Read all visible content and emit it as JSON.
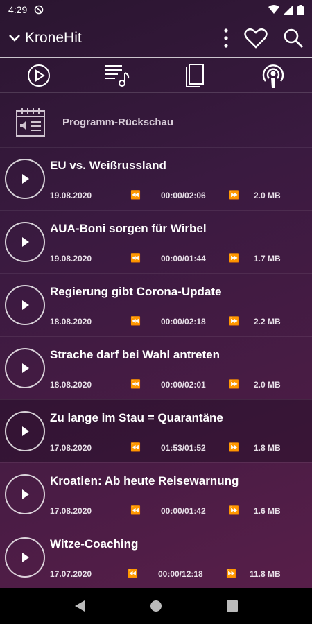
{
  "status": {
    "time": "4:29"
  },
  "appbar": {
    "title": "KroneHit"
  },
  "section": {
    "label": "Programm-Rückschau"
  },
  "episodes": [
    {
      "title": "EU vs. Weißrussland",
      "date": "19.08.2020",
      "position": "00:00/02:06",
      "size": "2.0 MB"
    },
    {
      "title": "AUA-Boni sorgen für Wirbel",
      "date": "19.08.2020",
      "position": "00:00/01:44",
      "size": "1.7 MB"
    },
    {
      "title": "Regierung gibt Corona-Update",
      "date": "18.08.2020",
      "position": "00:00/02:18",
      "size": "2.2 MB"
    },
    {
      "title": "Strache darf bei Wahl antreten",
      "date": "18.08.2020",
      "position": "00:00/02:01",
      "size": "2.0 MB"
    },
    {
      "title": "Zu lange im Stau = Quarantäne",
      "date": "17.08.2020",
      "position": "01:53/01:52",
      "size": "1.8 MB"
    },
    {
      "title": "Kroatien: Ab heute Reisewarnung",
      "date": "17.08.2020",
      "position": "00:00/01:42",
      "size": "1.6 MB"
    },
    {
      "title": "Witze-Coaching",
      "date": "17.07.2020",
      "position": "00:00/12:18",
      "size": "11.8 MB"
    }
  ],
  "icons": {
    "rewind": "⏪",
    "forward": "⏩"
  }
}
